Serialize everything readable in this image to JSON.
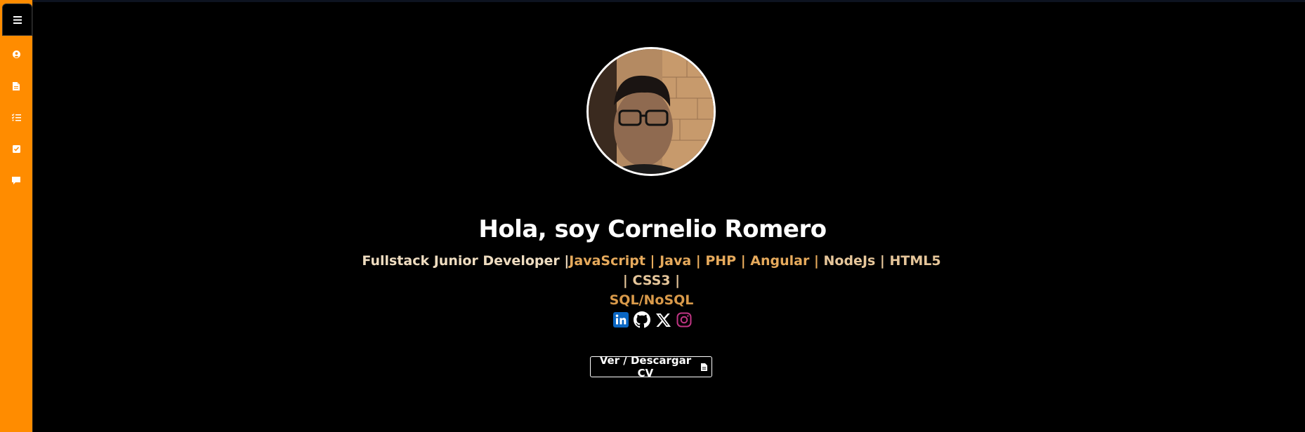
{
  "sidebar": {
    "toggle_icon": "hamburger-icon",
    "items": [
      {
        "icon": "user-circle-icon"
      },
      {
        "icon": "file-icon"
      },
      {
        "icon": "list-check-icon"
      },
      {
        "icon": "square-check-icon"
      },
      {
        "icon": "comment-icon"
      }
    ]
  },
  "hero": {
    "avatar_icon": "profile-photo",
    "title": "Hola, soy Cornelio Romero",
    "subtitle": {
      "part1": "Fullstack Junior Developer |",
      "part2": "JavaScript | Java | PHP | Angular | ",
      "part3": "NodeJs | HTML5 | CSS3 |",
      "part4": "SQL/NoSQL"
    }
  },
  "socials": [
    {
      "icon": "linkedin-icon",
      "color": "#0a66c2"
    },
    {
      "icon": "github-icon",
      "color": "#ffffff"
    },
    {
      "icon": "x-icon",
      "color": "#ffffff"
    },
    {
      "icon": "instagram-icon",
      "color": "#c13584"
    }
  ],
  "cv_button": {
    "label": "Ver / Descargar CV",
    "icon": "file-icon"
  },
  "colors": {
    "sidebar": "#ff8c00",
    "background": "#000000",
    "text": "#ffffff"
  }
}
